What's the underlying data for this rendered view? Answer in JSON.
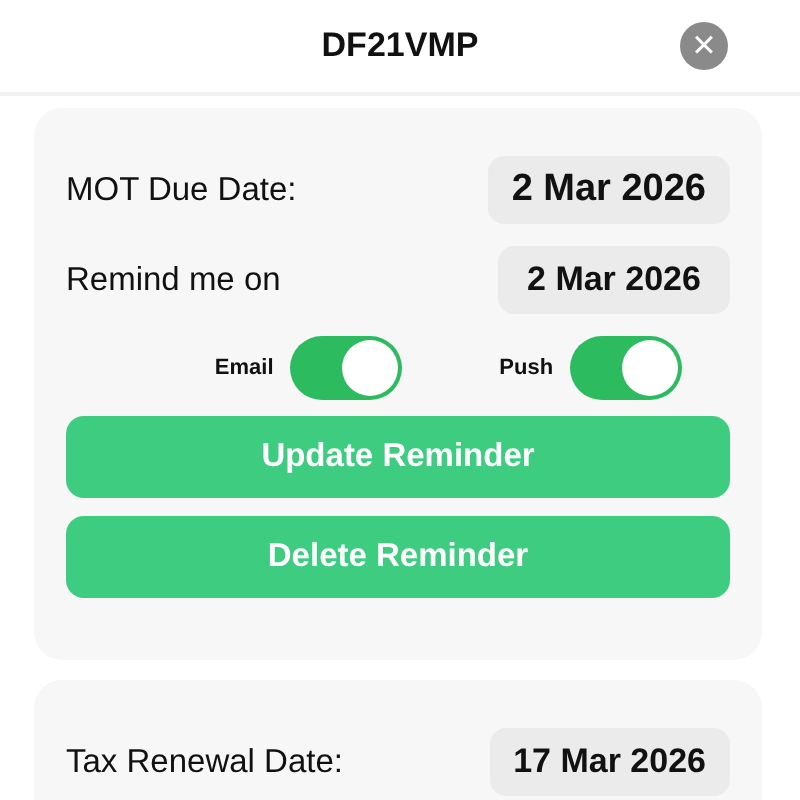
{
  "header": {
    "title": "DF21VMP",
    "close": "×"
  },
  "cards": [
    {
      "rows": [
        {
          "label": "MOT Due Date:",
          "value": "2 Mar 2026",
          "emphasis": true
        },
        {
          "label": "Remind me on",
          "value": "2 Mar 2026",
          "emphasis": false
        }
      ],
      "channels": [
        {
          "label": "Email",
          "on": true
        },
        {
          "label": "Push",
          "on": true
        }
      ],
      "buttons": [
        "Update Reminder",
        "Delete Reminder"
      ]
    },
    {
      "rows": [
        {
          "label": "Tax Renewal Date:",
          "value": "17 Mar 2026",
          "emphasis": false
        }
      ]
    }
  ]
}
